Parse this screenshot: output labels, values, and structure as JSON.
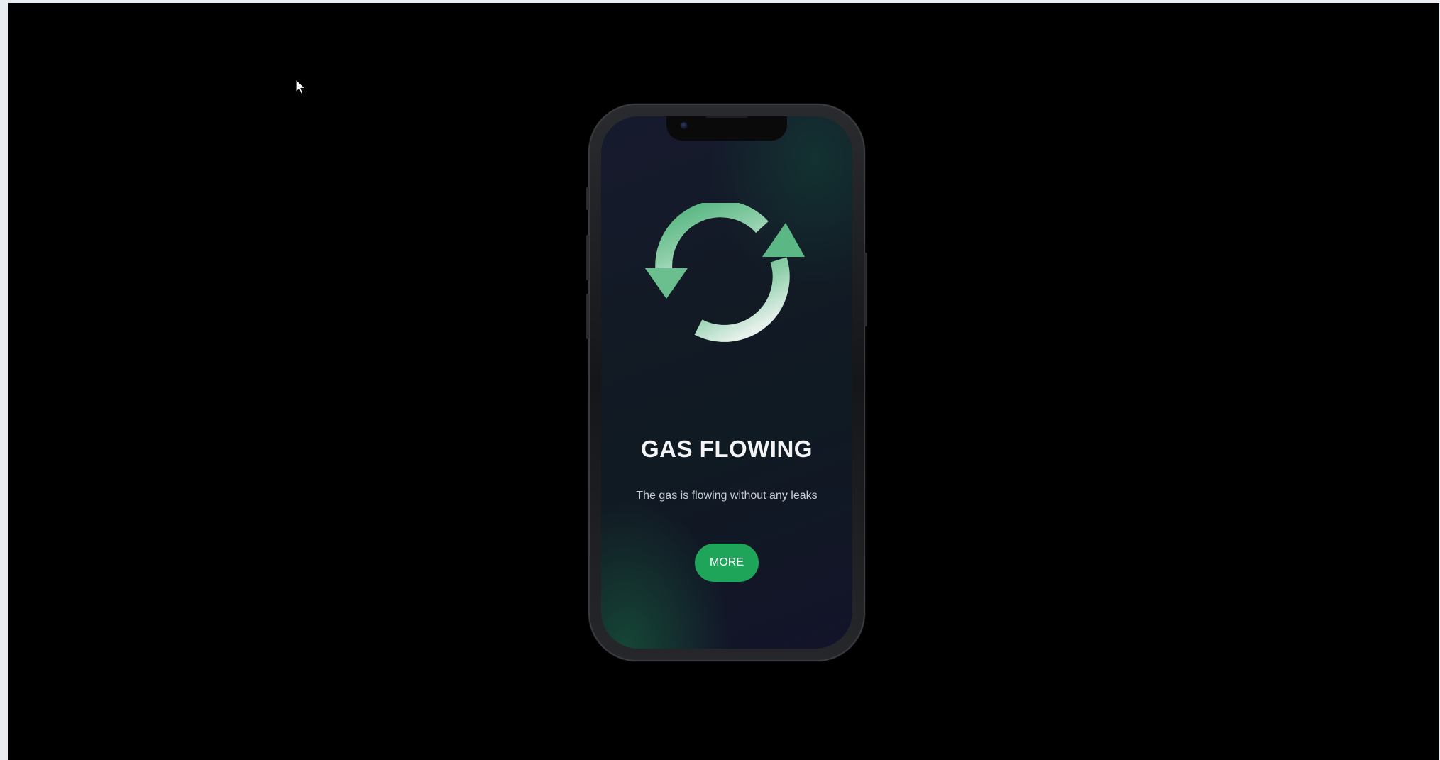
{
  "screen": {
    "icon": "sync-arrows-icon",
    "title": "GAS FLOWING",
    "description": "The gas is flowing without any leaks",
    "button_label": "MORE"
  },
  "colors": {
    "accent": "#1ea55a",
    "icon_gradient_start": "#4fb37c",
    "icon_gradient_end": "#e6f1ec",
    "page_background": "#000000"
  }
}
